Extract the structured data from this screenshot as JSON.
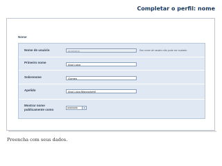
{
  "slide": {
    "title": "Completar o perfil: nome",
    "caption": "Preencha com seus dados."
  },
  "form": {
    "section_label": "Nome",
    "fields": [
      {
        "label": "Nome de usuário",
        "value": "anamaria",
        "hint": "Seu nome de usuário não pode ser mudado."
      },
      {
        "label": "Primeiro nome",
        "value": "Ana Luiza"
      },
      {
        "label": "Sobrenome",
        "value": "Gomes"
      },
      {
        "label": "Apelido",
        "value": "Ana Luiza Marzochetti"
      }
    ],
    "display": {
      "label_line1": "Mostrar nome",
      "label_line2": "publicamente como",
      "selected": "anamaria",
      "arrow": "▾"
    }
  },
  "colors": {
    "title": "#17365d",
    "form_background": "#dfe8f3",
    "form_border": "#b7c6d9"
  }
}
